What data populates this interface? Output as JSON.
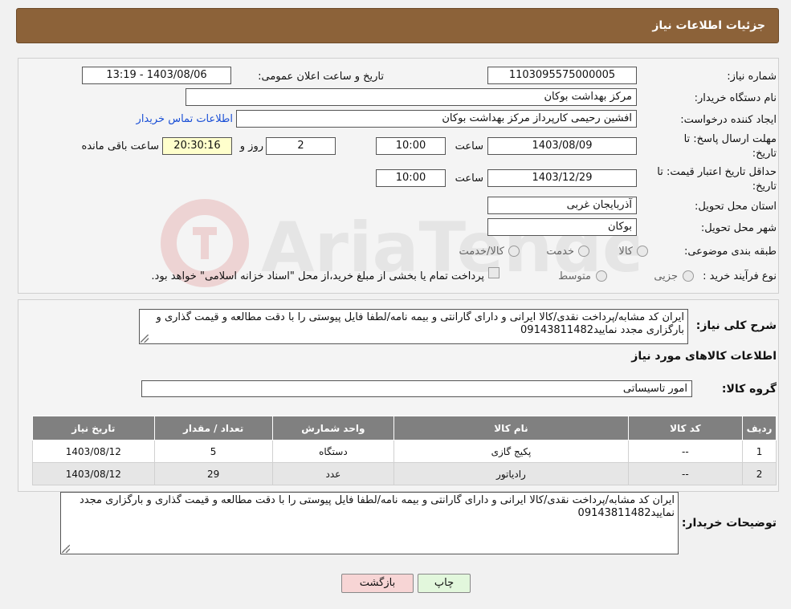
{
  "header": {
    "title": "جزئیات اطلاعات نیاز"
  },
  "form": {
    "need_number": {
      "label": "شماره نیاز:",
      "value": "1103095575000005"
    },
    "announce_datetime": {
      "label": "تاریخ و ساعت اعلان عمومی:",
      "value": "1403/08/06 - 13:19"
    },
    "buyer_name": {
      "label": "نام دستگاه خریدار:",
      "value": "مرکز بهداشت بوکان"
    },
    "requester": {
      "label": "ایجاد کننده درخواست:",
      "value": "افشین رحیمی کارپرداز مرکز بهداشت بوکان",
      "contact_link": "اطلاعات تماس خریدار"
    },
    "reply_deadline": {
      "label_line1": "مهلت ارسال پاسخ: تا",
      "label_line2": "تاریخ:",
      "date": "1403/08/09",
      "time_label": "ساعت",
      "time": "10:00",
      "days": "2",
      "days_label": "روز و",
      "remaining": "20:30:16",
      "remaining_label": "ساعت باقی مانده"
    },
    "price_validity": {
      "label_line1": "حداقل تاریخ اعتبار قیمت: تا",
      "label_line2": "تاریخ:",
      "date": "1403/12/29",
      "time_label": "ساعت",
      "time": "10:00"
    },
    "province": {
      "label": "استان محل تحویل:",
      "value": "آذربایجان غربی"
    },
    "city": {
      "label": "شهر محل تحویل:",
      "value": "بوکان"
    },
    "category": {
      "label": "طبقه بندی موضوعی:",
      "options": [
        "کالا",
        "خدمت",
        "کالا/خدمت"
      ]
    },
    "purchase_type": {
      "label": "نوع فرآیند خرید :",
      "options": [
        "جزیی",
        "متوسط"
      ],
      "note": "پرداخت تمام یا بخشی از مبلغ خرید،از محل \"اسناد خزانه اسلامی\" خواهد بود."
    }
  },
  "description": {
    "label": "شرح کلی نیاز:",
    "text": "ایران کد مشابه/پرداخت نقدی/کالا ایرانی و دارای گارانتی و بیمه نامه/لطفا فایل پیوستی را با دقت مطالعه و قیمت گذاری و بارگزاری مجدد نمایید09143811482"
  },
  "items_section": {
    "title": "اطلاعات کالاهای مورد نیاز",
    "group_label": "گروه کالا:",
    "group_value": "امور تاسیساتی"
  },
  "table": {
    "headers": [
      "ردیف",
      "کد کالا",
      "نام کالا",
      "واحد شمارش",
      "تعداد / مقدار",
      "تاریخ نیاز"
    ],
    "rows": [
      [
        "1",
        "--",
        "پکیج گازی",
        "دستگاه",
        "5",
        "1403/08/12"
      ],
      [
        "2",
        "--",
        "رادیاتور",
        "عدد",
        "29",
        "1403/08/12"
      ]
    ]
  },
  "buyer_notes": {
    "label": "توضیحات خریدار:",
    "text": "ایران کد مشابه/پرداخت نقدی/کالا ایرانی و دارای گارانتی و بیمه نامه/لطفا فایل پیوستی را با دقت مطالعه و قیمت گذاری و بارگزاری مجدد نمایید09143811482"
  },
  "buttons": {
    "print": "چاپ",
    "back": "بازگشت"
  },
  "watermark_text": "AriaTender.neT",
  "colors": {
    "header": "#8c6239",
    "link": "#1a4fd6",
    "remaining_bg": "#ffffcc",
    "back_button_bg": "#f7d5d5",
    "print_button_bg": "#e2f7dc",
    "table_header": "#808080"
  }
}
